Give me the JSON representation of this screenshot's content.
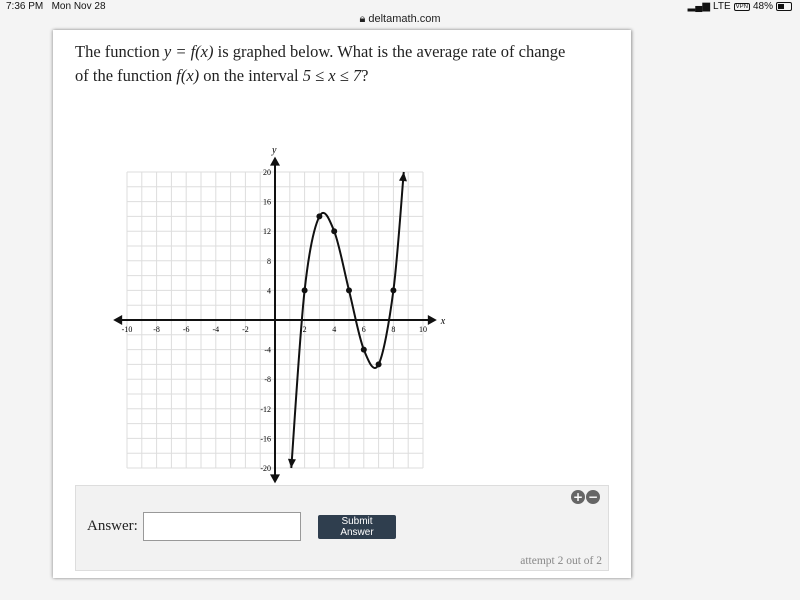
{
  "status_bar": {
    "time": "7:36 PM",
    "date": "Mon Nov 28",
    "carrier": "LTE",
    "vpn": "VPN",
    "battery": "48%"
  },
  "browser": {
    "url": "deltamath.com"
  },
  "question": {
    "line1_a": "The function ",
    "eq1": "y = f(x)",
    "line1_b": " is graphed below. What is the average rate of change",
    "line2_a": "of the function ",
    "eq2": "f(x)",
    "line2_b": " on the interval ",
    "eq3": "5 ≤ x ≤ 7",
    "line2_c": "?"
  },
  "chart_data": {
    "type": "line",
    "xlabel": "x",
    "ylabel": "y",
    "xlim": [
      -10,
      10
    ],
    "ylim": [
      -20,
      20
    ],
    "x_ticks": [
      -10,
      -8,
      -6,
      -4,
      -2,
      2,
      4,
      6,
      8,
      10
    ],
    "y_ticks": [
      20,
      16,
      12,
      8,
      4,
      -4,
      -8,
      -12,
      -16,
      -20
    ],
    "grid": true,
    "points": [
      {
        "x": 2,
        "y": 4
      },
      {
        "x": 3,
        "y": 14
      },
      {
        "x": 4,
        "y": 12
      },
      {
        "x": 5,
        "y": 4
      },
      {
        "x": 6,
        "y": -4
      },
      {
        "x": 7,
        "y": -6
      },
      {
        "x": 8,
        "y": 4
      }
    ],
    "curve_ends": [
      {
        "x": 1.1,
        "y": -20
      },
      {
        "x": 8.7,
        "y": 20
      }
    ]
  },
  "answer": {
    "label": "Answer:",
    "value": "",
    "submit": "Submit Answer",
    "attempt": "attempt 2 out of 2",
    "zoom_in": "+",
    "zoom_out": "−"
  }
}
